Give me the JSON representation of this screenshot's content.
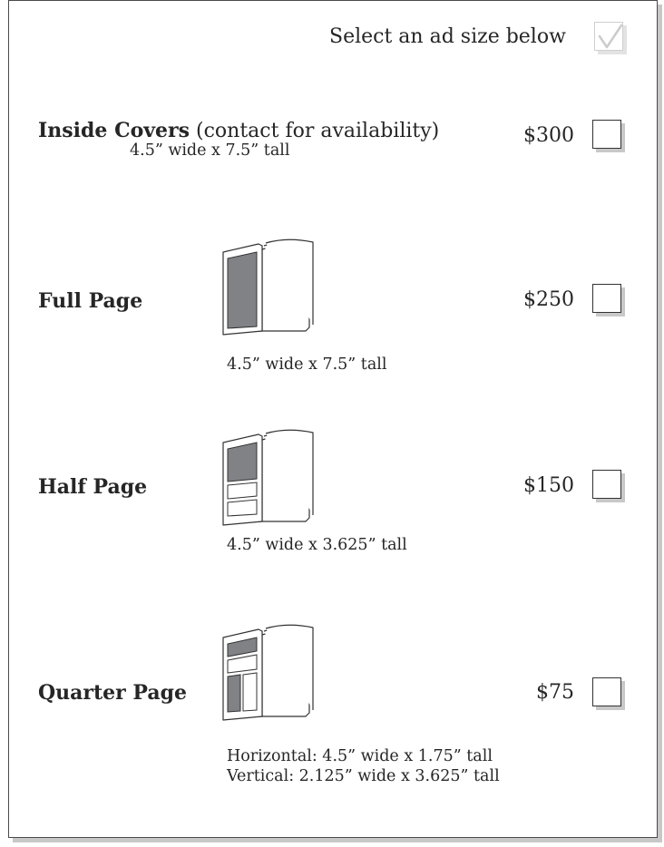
{
  "header": {
    "instruction": "Select an ad size below"
  },
  "options": {
    "inside_covers": {
      "title": "Inside Covers",
      "note": "(contact for availability)",
      "dimensions": "4.5” wide x 7.5” tall",
      "price": "$300",
      "checked": false
    },
    "full_page": {
      "title": "Full Page",
      "dimensions": "4.5” wide x 7.5” tall",
      "price": "$250",
      "checked": false,
      "icon": "full-page-layout-icon"
    },
    "half_page": {
      "title": "Half Page",
      "dimensions": "4.5” wide x 3.625” tall",
      "price": "$150",
      "checked": false,
      "icon": "half-page-layout-icon"
    },
    "quarter_page": {
      "title": "Quarter Page",
      "dimensions_horizontal": "Horizontal:  4.5” wide x 1.75” tall",
      "dimensions_vertical": "Vertical:  2.125” wide x 3.625” tall",
      "price": "$75",
      "checked": false,
      "icon": "quarter-page-layout-icon"
    }
  },
  "colors": {
    "ad_fill": "#808285",
    "border": "#333333",
    "shadow": "#c8c8c8"
  }
}
